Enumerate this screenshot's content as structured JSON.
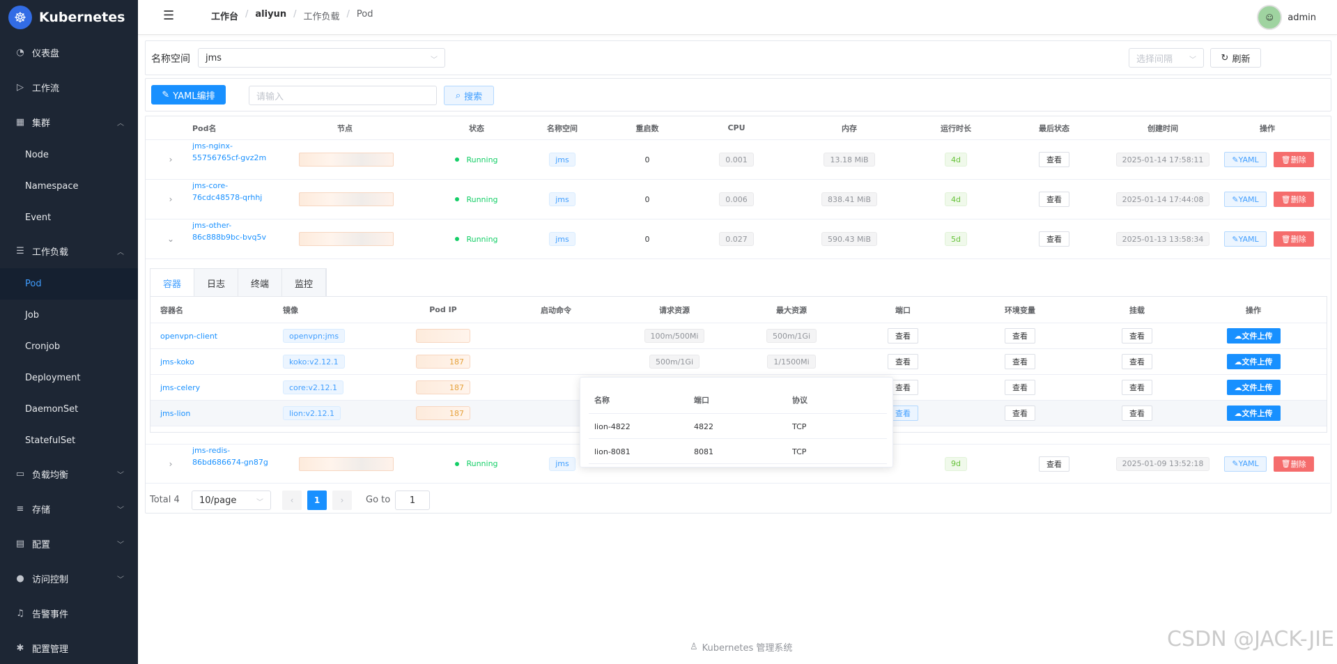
{
  "app": {
    "title": "Kubernetes",
    "logo_icon": "kubernetes-wheel-icon",
    "footer": "Kubernetes 管理系统",
    "watermark": "CSDN @JACK-JIE"
  },
  "sidebar": {
    "dashboard": "仪表盘",
    "workflow": "工作流",
    "cluster": "集群",
    "cluster_items": [
      "Node",
      "Namespace",
      "Event"
    ],
    "workload": "工作负载",
    "workload_items": [
      "Pod",
      "Job",
      "Cronjob",
      "Deployment",
      "DaemonSet",
      "StatefulSet"
    ],
    "loadbalance": "负载均衡",
    "storage": "存储",
    "config": "配置",
    "access": "访问控制",
    "alert": "告警事件",
    "config_mgmt": "配置管理"
  },
  "header": {
    "breadcrumb": [
      "工作台",
      "aliyun",
      "工作负载",
      "Pod"
    ],
    "separator": "/",
    "user": "admin"
  },
  "filter": {
    "namespace_label": "名称空间",
    "namespace_value": "jms",
    "interval_placeholder": "选择间隔",
    "refresh": "刷新"
  },
  "toolbar": {
    "yaml_btn": "YAML编排",
    "search_placeholder": "请输入",
    "search_btn": "搜索"
  },
  "table": {
    "columns": [
      "Pod名",
      "节点",
      "状态",
      "名称空间",
      "重启数",
      "CPU",
      "内存",
      "运行时长",
      "最后状态",
      "创建时间",
      "操作"
    ],
    "view_label": "查看",
    "yaml_label": "YAML",
    "delete_label": "删除",
    "rows": [
      {
        "name1": "jms-nginx-",
        "name2": "55756765cf-gvz2m",
        "status": "Running",
        "ns": "jms",
        "restarts": "0",
        "cpu": "0.001",
        "mem": "13.18 MiB",
        "age": "4d",
        "created": "2025-01-14 17:58:11"
      },
      {
        "name1": "jms-core-",
        "name2": "76cdc48578-qrhhj",
        "status": "Running",
        "ns": "jms",
        "restarts": "0",
        "cpu": "0.006",
        "mem": "838.41 MiB",
        "age": "4d",
        "created": "2025-01-14 17:44:08"
      },
      {
        "name1": "jms-other-",
        "name2": "86c888b9bc-bvq5v",
        "status": "Running",
        "ns": "jms",
        "restarts": "0",
        "cpu": "0.027",
        "mem": "590.43 MiB",
        "age": "5d",
        "created": "2025-01-13 13:58:34"
      },
      {
        "name1": "jms-redis-",
        "name2": "86bd686674-gn87g",
        "status": "Running",
        "ns": "jms",
        "restarts": "",
        "cpu": "",
        "mem": "",
        "age": "9d",
        "created": "2025-01-09 13:52:18"
      }
    ]
  },
  "detail_tabs": [
    "容器",
    "日志",
    "终端",
    "监控"
  ],
  "containers": {
    "columns": [
      "容器名",
      "镜像",
      "Pod IP",
      "启动命令",
      "请求资源",
      "最大资源",
      "端口",
      "环境变量",
      "挂载",
      "操作"
    ],
    "upload_label": "文件上传",
    "rows": [
      {
        "name": "openvpn-client",
        "image": "openvpn:jms",
        "ip": "",
        "req": "100m/500Mi",
        "max": "500m/1Gi"
      },
      {
        "name": "jms-koko",
        "image": "koko:v2.12.1",
        "ip": "187",
        "req": "500m/1Gi",
        "max": "1/1500Mi"
      },
      {
        "name": "jms-celery",
        "image": "core:v2.12.1",
        "ip": "187",
        "req": "",
        "max": ""
      },
      {
        "name": "jms-lion",
        "image": "lion:v2.12.1",
        "ip": "187",
        "req": "",
        "max": ""
      }
    ]
  },
  "popover": {
    "columns": [
      "名称",
      "端口",
      "协议"
    ],
    "rows": [
      {
        "name": "lion-4822",
        "port": "4822",
        "proto": "TCP"
      },
      {
        "name": "lion-8081",
        "port": "8081",
        "proto": "TCP"
      }
    ]
  },
  "pagination": {
    "total": "Total 4",
    "page_size": "10/page",
    "current": "1",
    "goto_label": "Go to",
    "goto_value": "1"
  }
}
